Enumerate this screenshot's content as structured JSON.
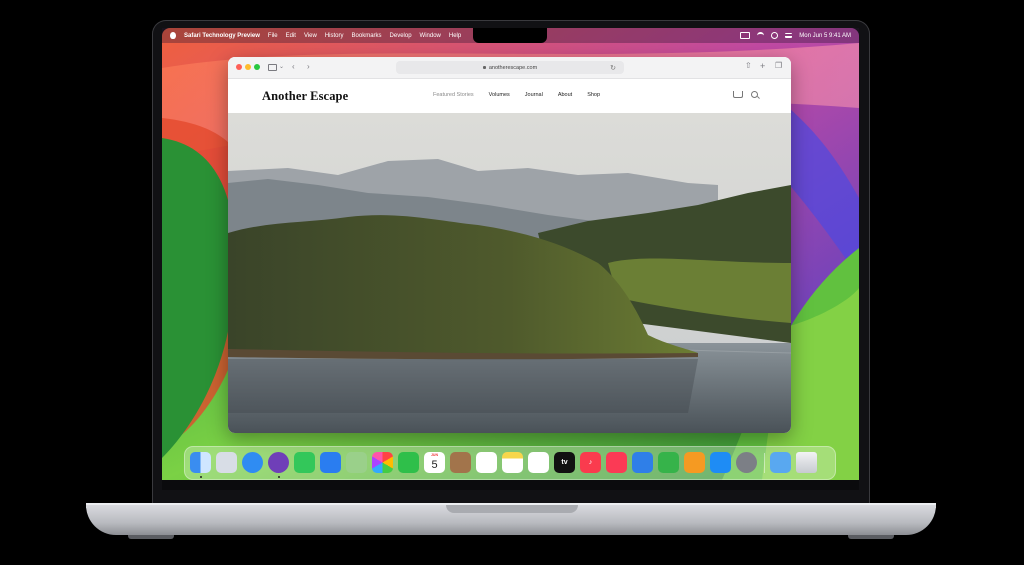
{
  "menubar": {
    "app_name": "Safari Technology Preview",
    "items": [
      "File",
      "Edit",
      "View",
      "History",
      "Bookmarks",
      "Develop",
      "Window",
      "Help"
    ],
    "clock": "Mon Jun 5  9:41 AM"
  },
  "browser": {
    "url": "anotherescape.com"
  },
  "site": {
    "logo": "Another Escape",
    "nav": [
      "Featured Stories",
      "Volumes",
      "Journal",
      "About",
      "Shop"
    ]
  },
  "dock": {
    "calendar_month": "JUN",
    "calendar_day": "5",
    "tv_label": "tv",
    "apps": [
      "finder-icon",
      "launchpad-icon",
      "safari-icon",
      "safari-preview-icon",
      "messages-icon",
      "mail-icon",
      "maps-icon",
      "photos-icon",
      "facetime-icon",
      "calendar-icon",
      "contacts-icon",
      "reminders-icon",
      "notes-icon",
      "freeform-icon",
      "tv-icon",
      "music-icon",
      "news-icon",
      "keynote-icon",
      "numbers-icon",
      "pages-icon",
      "app-store-icon",
      "system-settings-icon",
      "downloads-icon",
      "trash-icon"
    ]
  },
  "colors": {
    "traffic_close": "#fe5f57",
    "traffic_min": "#febc2e",
    "traffic_max": "#28c840"
  }
}
